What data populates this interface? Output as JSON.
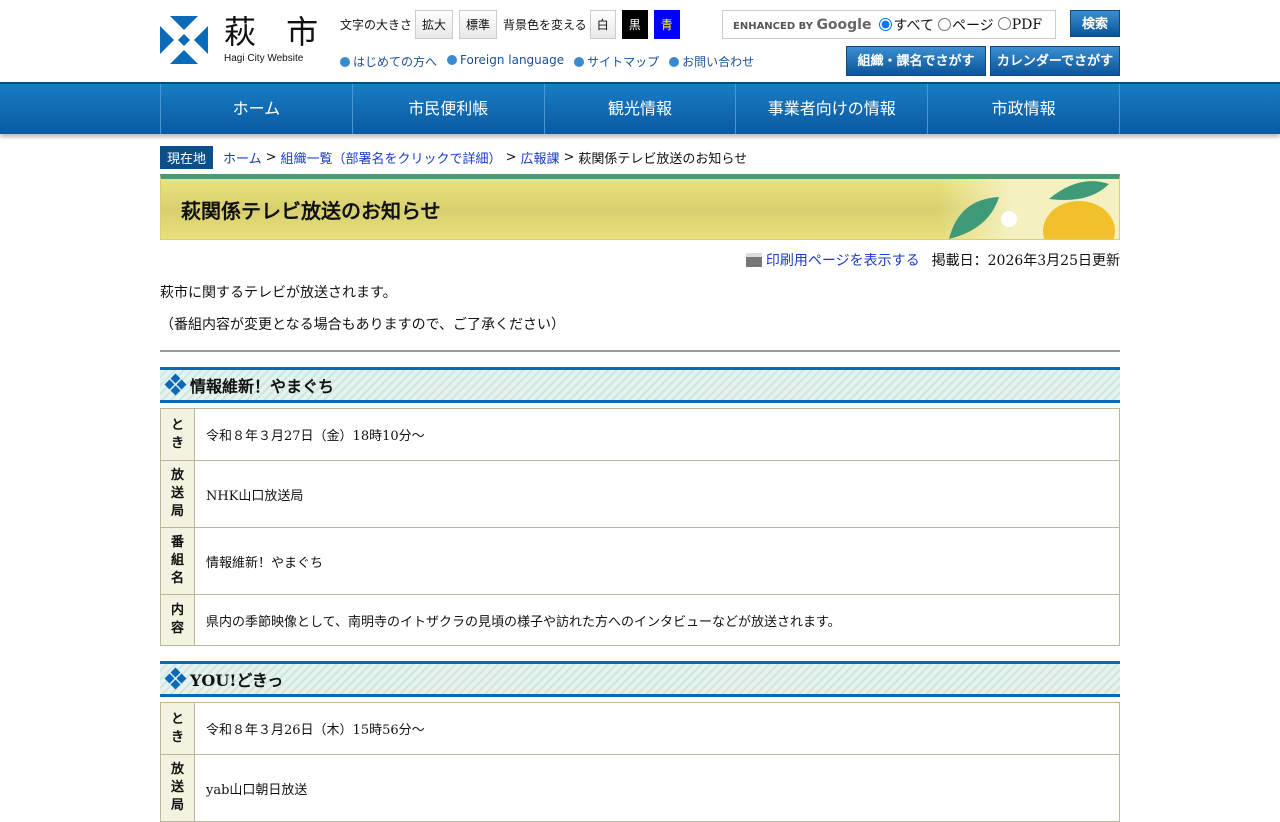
{
  "header": {
    "logo_text": "萩 市",
    "logo_sub": "Hagi City Website",
    "font_size_label": "文字の大きさ",
    "enlarge": "拡大",
    "standard": "標準",
    "bg_label": "背景色を変える",
    "bg_white": "白",
    "bg_black": "黒",
    "bg_blue": "青",
    "links": [
      "はじめての方へ",
      "Foreign language",
      "サイトマップ",
      "お問い合わせ"
    ],
    "search": {
      "enhanced": "ENHANCED BY",
      "google": "Google",
      "opt_all": "すべて",
      "opt_page": "ページ",
      "opt_pdf": "PDF",
      "button": "検索"
    },
    "org_search": "組織・課名でさがす",
    "calendar_search": "カレンダーでさがす"
  },
  "nav": [
    "ホーム",
    "市民便利帳",
    "観光情報",
    "事業者向けの情報",
    "市政情報"
  ],
  "breadcrumb": {
    "here": "現在地",
    "items": [
      "ホーム",
      "組織一覧（部署名をクリックで詳細）",
      "広報課"
    ],
    "current": "萩関係テレビ放送のお知らせ",
    "sep": ">"
  },
  "page": {
    "title": "萩関係テレビ放送のお知らせ",
    "print": "印刷用ページを表示する",
    "date": "掲載日：2026年3月25日更新",
    "intro1": "萩市に関するテレビが放送されます。",
    "intro2": "（番組内容が変更となる場合もありますので、ご了承ください）"
  },
  "programs": [
    {
      "title": "情報維新！やまぐち",
      "rows": [
        {
          "label": "とき",
          "value": "令和８年３月27日（金）18時10分～"
        },
        {
          "label": "放送局",
          "value": "NHK山口放送局"
        },
        {
          "label": "番組名",
          "value": "情報維新！やまぐち"
        },
        {
          "label": "内容",
          "value": "県内の季節映像として、南明寺のイトザクラの見頃の様子や訪れた方へのインタビューなどが放送されます。"
        }
      ]
    },
    {
      "title": "YOU!どきっ",
      "rows": [
        {
          "label": "とき",
          "value": "令和８年３月26日（木）15時56分～"
        },
        {
          "label": "放送局",
          "value": "yab山口朝日放送"
        }
      ]
    }
  ]
}
